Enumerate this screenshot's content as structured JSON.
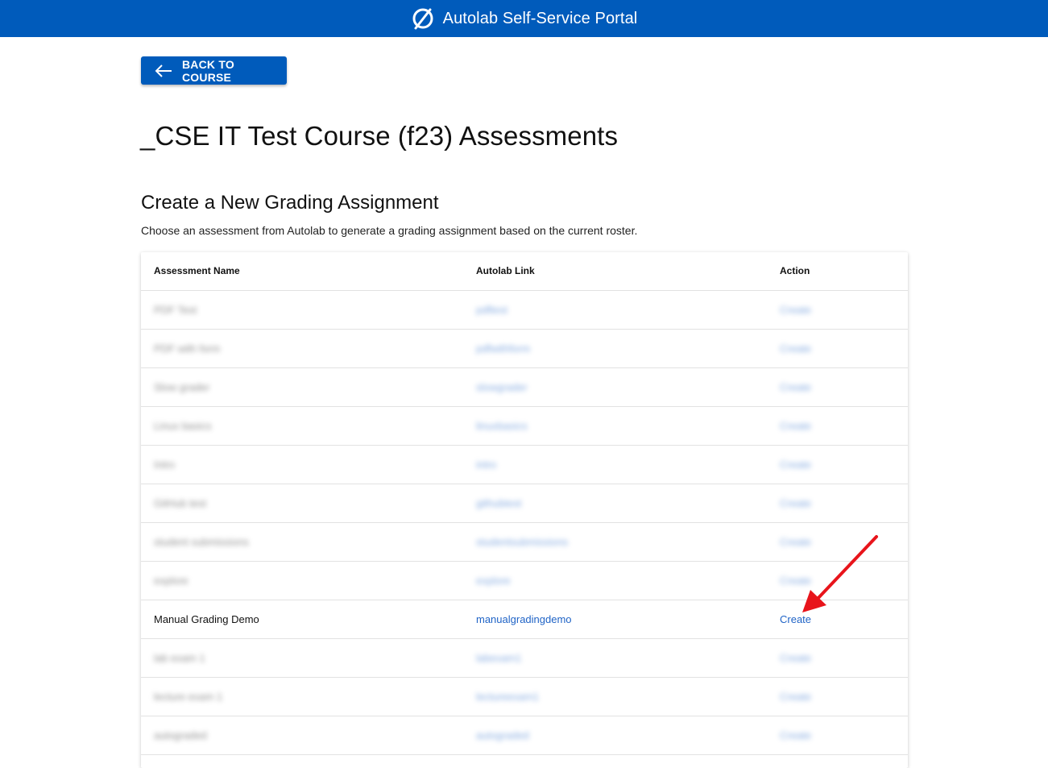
{
  "header": {
    "title": "Autolab Self-Service Portal",
    "icon": "slashed-circle-icon",
    "background": "#005bbb"
  },
  "back_button": {
    "label": "BACK TO COURSE",
    "icon": "arrow-left-icon"
  },
  "page_title": "_CSE IT Test Course (f23) Assessments",
  "section": {
    "title": "Create a New Grading Assignment",
    "description": "Choose an assessment from Autolab to generate a grading assignment based on the current roster."
  },
  "table": {
    "columns": [
      "Assessment Name",
      "Autolab Link",
      "Action"
    ],
    "rows": [
      {
        "name": "PDF Test",
        "link": "pdftest",
        "action": "Create",
        "blurred": true
      },
      {
        "name": "PDF with form",
        "link": "pdfwithform",
        "action": "Create",
        "blurred": true
      },
      {
        "name": "Slow grader",
        "link": "slowgrader",
        "action": "Create",
        "blurred": true
      },
      {
        "name": "Linux basics",
        "link": "linuxbasics",
        "action": "Create",
        "blurred": true
      },
      {
        "name": "Intro",
        "link": "intro",
        "action": "Create",
        "blurred": true
      },
      {
        "name": "GitHub test",
        "link": "githubtest",
        "action": "Create",
        "blurred": true
      },
      {
        "name": "student submissions",
        "link": "studentsubmissions",
        "action": "Create",
        "blurred": true
      },
      {
        "name": "explore",
        "link": "explore",
        "action": "Create",
        "blurred": true
      },
      {
        "name": "Manual Grading Demo",
        "link": "manualgradingdemo",
        "action": "Create",
        "blurred": false
      },
      {
        "name": "lab exam 1",
        "link": "labexam1",
        "action": "Create",
        "blurred": true
      },
      {
        "name": "lecture exam 1",
        "link": "lectureexam1",
        "action": "Create",
        "blurred": true
      },
      {
        "name": "autograded",
        "link": "autograded",
        "action": "Create",
        "blurred": true
      }
    ]
  },
  "colors": {
    "brand": "#005bbb",
    "link": "#1f63c6",
    "annotation": "#e8141b"
  }
}
